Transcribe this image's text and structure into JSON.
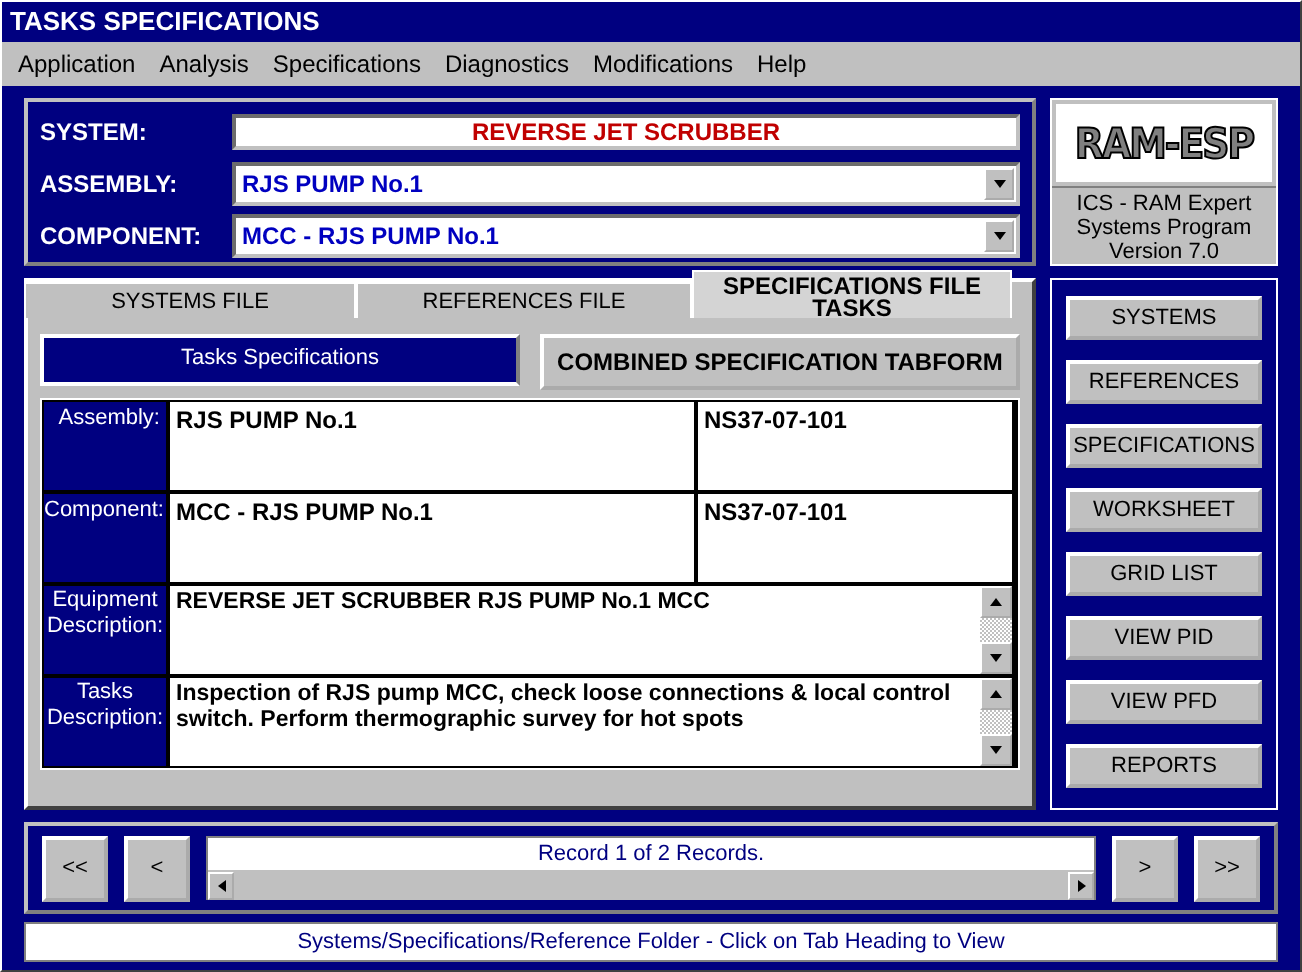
{
  "window": {
    "title": "TASKS SPECIFICATIONS"
  },
  "menu": [
    "Application",
    "Analysis",
    "Specifications",
    "Diagnostics",
    "Modifications",
    "Help"
  ],
  "header": {
    "system_label": "SYSTEM:",
    "system": "REVERSE JET SCRUBBER",
    "assembly_label": "ASSEMBLY:",
    "assembly": "RJS PUMP No.1",
    "component_label": "COMPONENT:",
    "component": "MCC -  RJS PUMP No.1"
  },
  "logo": {
    "mark": "RAM-ESP",
    "caption": "ICS - RAM Expert Systems Program Version 7.0"
  },
  "tabs": [
    {
      "label": "SYSTEMS FILE",
      "selected": false
    },
    {
      "label": "REFERENCES FILE",
      "selected": false
    },
    {
      "label": "SPECIFICATIONS FILE TASKS",
      "selected": true
    }
  ],
  "form": {
    "heading": "Tasks Specifications",
    "combined_button": "COMBINED SPECIFICATION TABFORM",
    "rows": [
      {
        "kind": "field",
        "label": "Assembly:",
        "value": "RJS PUMP No.1",
        "code": "NS37-07-101"
      },
      {
        "kind": "field",
        "label": "Component:",
        "value": "MCC -  RJS PUMP No.1",
        "code": "NS37-07-101"
      },
      {
        "kind": "memo",
        "label": "Equipment Description:",
        "value": "REVERSE JET SCRUBBER RJS PUMP No.1 MCC"
      },
      {
        "kind": "memo",
        "label": "Tasks Description:",
        "value": "Inspection of RJS pump MCC, check loose connections & local control switch. Perform thermographic survey for hot spots"
      }
    ]
  },
  "side_buttons": [
    "SYSTEMS",
    "REFERENCES",
    "SPECIFICATIONS",
    "WORKSHEET",
    "GRID LIST",
    "VIEW PID",
    "VIEW PFD",
    "REPORTS"
  ],
  "navigator": {
    "first": "<<",
    "previous": "<",
    "record": "Record 1 of 2 Records.",
    "next": ">",
    "last": ">>"
  },
  "status_bar": "Systems/Specifications/Reference Folder - Click on Tab Heading to View"
}
